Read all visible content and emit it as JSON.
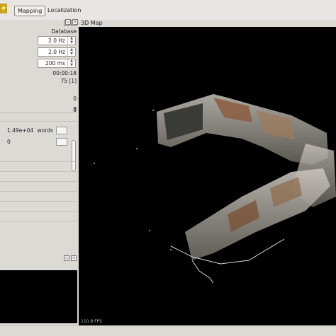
{
  "toolbar": {
    "mapping_label": "Mapping",
    "localization_label": "Localization",
    "app_icon": "lightning-icon"
  },
  "left_panel": {
    "dock_icons": [
      "float-icon",
      "close-icon"
    ],
    "database_label": "Database",
    "detection_rate": "2.0 Hz",
    "publish_rate": "2.0 Hz",
    "time_threshold": "200 ms",
    "elapsed_time": "00:00:18",
    "node_count": "75 [1]",
    "value_a": "0",
    "value_b": "0",
    "value_c": "3",
    "dictionary_size": "1.49e+04",
    "words_label": "words",
    "value_d": "0"
  },
  "map_view": {
    "title": "3D Map",
    "fps": "110.8 FPS",
    "dock_icons": [
      "float-icon",
      "close-icon"
    ],
    "background": "#000000"
  }
}
